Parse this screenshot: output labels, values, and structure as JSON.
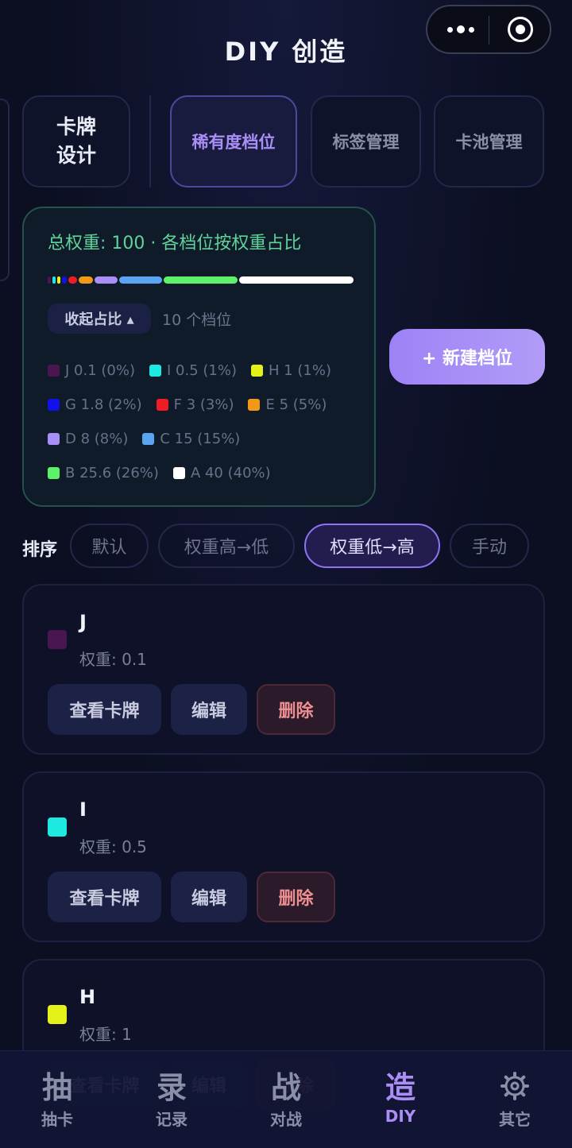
{
  "header": {
    "title": "DIY 创造"
  },
  "tabs": [
    {
      "label": "卡牌\n设计",
      "lines": [
        "卡牌",
        "设计"
      ]
    },
    {
      "label": "稀有度档位"
    },
    {
      "label": "标签管理"
    },
    {
      "label": "卡池管理"
    }
  ],
  "summary": {
    "total_text": "总权重: 100 · 各档位按权重占比",
    "collapse_label": "收起占比 ▴",
    "count_text": "10 个档位",
    "legend": [
      {
        "label": "J 0.1 (0%)",
        "color": "#4a1650",
        "weight": 0.1
      },
      {
        "label": "I 0.5 (1%)",
        "color": "#1de9e0",
        "weight": 0.5
      },
      {
        "label": "H 1 (1%)",
        "color": "#e4f21a",
        "weight": 1
      },
      {
        "label": "G 1.8 (2%)",
        "color": "#1212e8",
        "weight": 1.8
      },
      {
        "label": "F 3 (3%)",
        "color": "#ee1c24",
        "weight": 3
      },
      {
        "label": "E 5 (5%)",
        "color": "#f29a18",
        "weight": 5
      },
      {
        "label": "D 8 (8%)",
        "color": "#a98ef5",
        "weight": 8
      },
      {
        "label": "C 15 (15%)",
        "color": "#5aa4f2",
        "weight": 15
      },
      {
        "label": "B 25.6 (26%)",
        "color": "#5ef26a",
        "weight": 25.6
      },
      {
        "label": "A 40 (40%)",
        "color": "#ffffff",
        "weight": 40
      }
    ]
  },
  "new_tier_label": "+ 新建档位",
  "sort": {
    "label": "排序",
    "options": [
      "默认",
      "权重高→低",
      "权重低→高",
      "手动"
    ],
    "selected": "权重低→高"
  },
  "tiers": [
    {
      "name": "J",
      "weight_text": "权重: 0.1",
      "color": "#4a1650"
    },
    {
      "name": "I",
      "weight_text": "权重: 0.5",
      "color": "#1de9e0"
    },
    {
      "name": "H",
      "weight_text": "权重: 1",
      "color": "#e4f21a"
    }
  ],
  "tier_actions": {
    "view": "查看卡牌",
    "edit": "编辑",
    "delete": "删除"
  },
  "nav": [
    {
      "glyph": "抽",
      "label": "抽卡"
    },
    {
      "glyph": "录",
      "label": "记录"
    },
    {
      "glyph": "战",
      "label": "对战"
    },
    {
      "glyph": "造",
      "label": "DIY",
      "active": true
    },
    {
      "icon": "gear-icon",
      "label": "其它"
    }
  ],
  "colors": {
    "accent": "#a88ef5",
    "success_text": "#5fd39a",
    "danger_text": "#ef8f92"
  }
}
